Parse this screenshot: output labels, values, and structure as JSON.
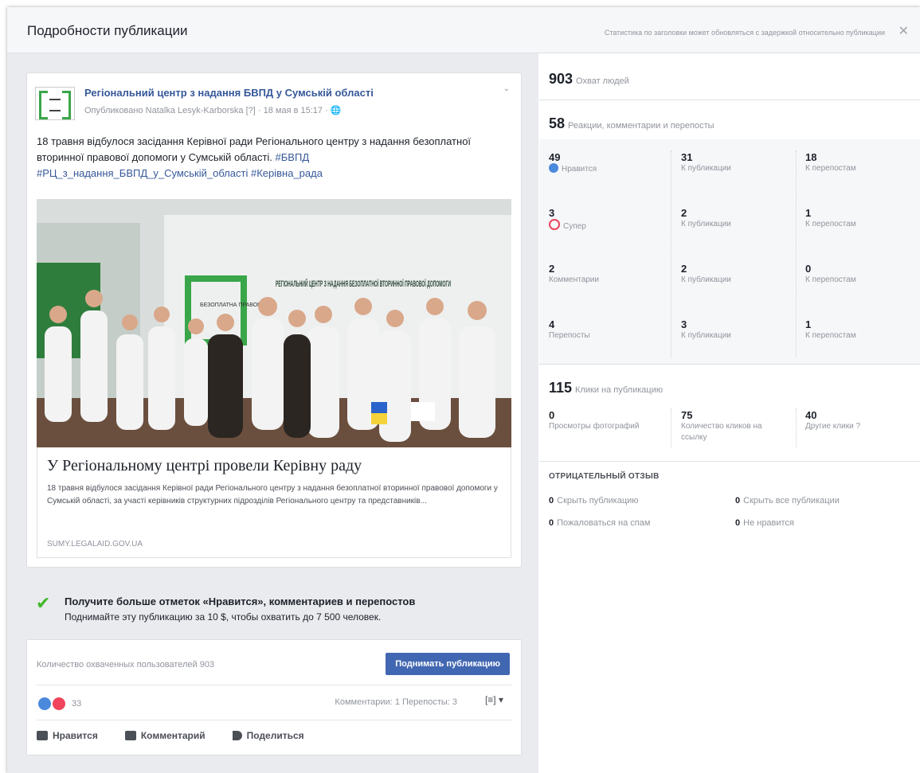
{
  "modal": {
    "title": "Подробности публикации",
    "notice": "Статистика по заголовки может обновляться с задержкой относительно публикации",
    "close": "✕"
  },
  "post": {
    "page_name": "Регіональний центр з надання БВПД у Сумській області",
    "meta": "Опубликовано Natalka Lesyk-Karborska [?] · 18 мая в 15:17 · 🌐",
    "menu": "⌄",
    "text": "18 травня відбулося засідання Керівної ради Регіонального центру з надання безоплатної вторинної правової допомоги у Сумській області.",
    "tags": "#БВПД #РЦ_з_надання_БВПД_у_Сумській_області #Керівна_рада",
    "photo_banner": "РЕГІОНАЛЬНИЙ ЦЕНТР З НАДАННЯ БЕЗОПЛАТНОЇ ВТОРИННОЇ ПРАВОВОЇ ДОПОМОГИ",
    "photo_logo": "БЕЗОПЛАТНА ПРАВОВА",
    "link_title": "У Регіональному центрі провели Керівну раду",
    "link_desc": "18 травня відбулося засідання Керівної ради Регіонального центру з надання безоплатної вторинної правової допомоги у Сумській області, за участі керівників структурних підрозділів Регіонального центру та представників...",
    "link_domain": "SUMY.LEGALAID.GOV.UA"
  },
  "boost": {
    "title": "Получите больше отметок «Нравится», комментариев и перепостов",
    "subtitle": "Поднимайте эту публикацию за 10 $, чтобы охватить до 7 500 человек."
  },
  "footer": {
    "reach_text": "Количество охваченных пользователей 903",
    "promote_label": "Поднимать публикацию",
    "reaction_count": "33",
    "counts": "Комментарии: 1  Перепосты: 3",
    "share_menu": "[≡] ▾",
    "actions": {
      "like": "Нравится",
      "comment": "Комментарий",
      "share": "Поделиться"
    }
  },
  "stats": {
    "reach": {
      "value": "903",
      "label": "Охват людей"
    },
    "engagement": {
      "value": "58",
      "label": "Реакции, комментарии и перепосты"
    },
    "rows": [
      {
        "cells": [
          {
            "num": "49",
            "label": "Нравится"
          },
          {
            "num": "31",
            "label": "К публикации"
          },
          {
            "num": "18",
            "label": "К перепостам"
          }
        ]
      },
      {
        "cells": [
          {
            "num": "3",
            "label": "Супер"
          },
          {
            "num": "2",
            "label": "К публикации"
          },
          {
            "num": "1",
            "label": "К перепостам"
          }
        ]
      },
      {
        "cells": [
          {
            "num": "2",
            "label": "Комментарии"
          },
          {
            "num": "2",
            "label": "К публикации"
          },
          {
            "num": "0",
            "label": "К перепостам"
          }
        ]
      },
      {
        "cells": [
          {
            "num": "4",
            "label": "Перепосты"
          },
          {
            "num": "3",
            "label": "К публикации"
          },
          {
            "num": "1",
            "label": "К перепостам"
          }
        ]
      }
    ],
    "clicks": {
      "value": "115",
      "label": "Клики на публикацию"
    },
    "click_cells": [
      {
        "num": "0",
        "label": "Просмотры фотографий"
      },
      {
        "num": "75",
        "label": "Количество кликов на ссылку"
      },
      {
        "num": "40",
        "label": "Другие клики ?"
      }
    ],
    "negative_title": "ОТРИЦАТЕЛЬНЫЙ ОТЗЫВ",
    "negative": [
      {
        "num": "0",
        "label": "Скрыть публикацию"
      },
      {
        "num": "0",
        "label": "Скрыть все публикации"
      },
      {
        "num": "0",
        "label": "Пожаловаться на спам"
      },
      {
        "num": "0",
        "label": "Не нравится"
      }
    ]
  }
}
